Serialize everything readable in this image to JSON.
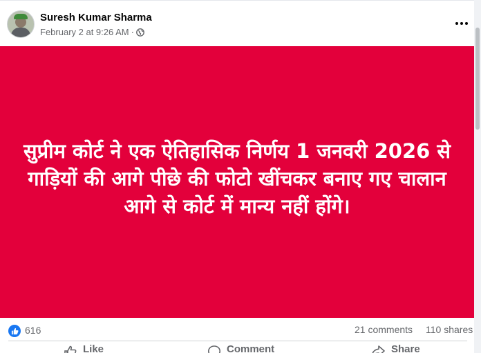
{
  "post": {
    "author": "Suresh Kumar Sharma",
    "timestamp": "February 2 at 9:26 AM",
    "separator": "·",
    "audience_icon": "globe-icon",
    "more_icon": "more-options-icon",
    "image_text": "सुप्रीम कोर्ट ने एक ऐतिहासिक निर्णय 1 जनवरी 2026 से गाड़ियों की आगे पीछे की फोटो खींचकर बनाए गए चालान आगे से कोर्ट में मान्य नहीं होंगे।",
    "image_background": "#e3003b"
  },
  "stats": {
    "reaction_icon": "like-reaction-icon",
    "reactions": "616",
    "comments": "21 comments",
    "shares": "110 shares"
  },
  "actions": {
    "like": "Like",
    "comment": "Comment",
    "share": "Share"
  },
  "colors": {
    "accent": "#1877f2",
    "secondary_text": "#65676b"
  }
}
